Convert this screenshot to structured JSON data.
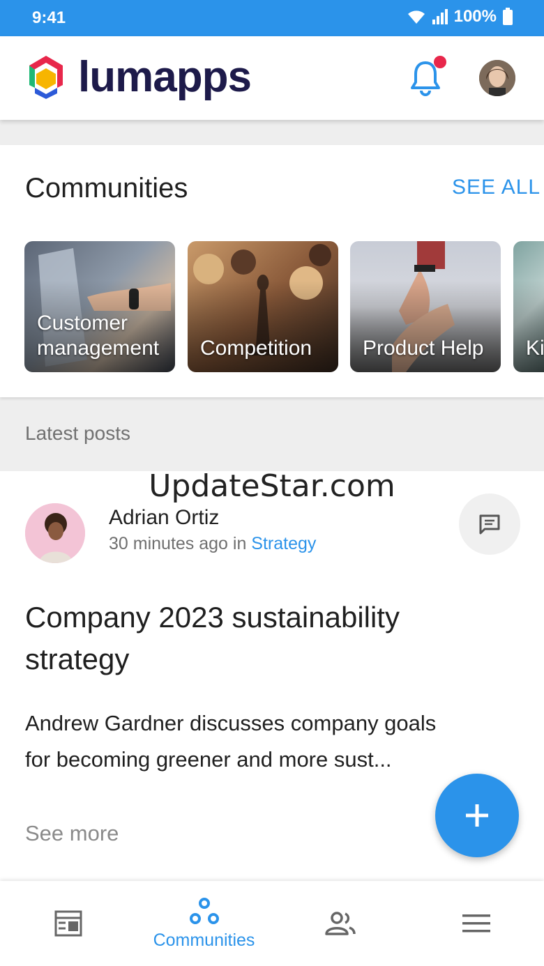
{
  "status_bar": {
    "time": "9:41",
    "battery": "100%"
  },
  "app_bar": {
    "logo_text": "lumapps",
    "avatar_alt": "user avatar"
  },
  "communities": {
    "title": "Communities",
    "see_all": "SEE ALL",
    "tiles": [
      {
        "label": "Customer management"
      },
      {
        "label": "Competition"
      },
      {
        "label": "Product Help"
      },
      {
        "label": "Ki"
      }
    ]
  },
  "latest_posts": {
    "title": "Latest posts"
  },
  "watermark": "UpdateStar.com",
  "post": {
    "author": "Adrian Ortiz",
    "time_ago": "30 minutes ago in ",
    "community": "Strategy",
    "title": "Company 2023 sustainability strategy",
    "excerpt": "Andrew Gardner discusses company goals for becoming greener and more sust...",
    "see_more": "See more"
  },
  "bottom_nav": {
    "items": [
      {
        "icon": "feed-icon",
        "label": ""
      },
      {
        "icon": "communities-icon",
        "label": "Communities",
        "active": true
      },
      {
        "icon": "people-icon",
        "label": ""
      },
      {
        "icon": "menu-icon",
        "label": ""
      }
    ]
  },
  "colors": {
    "accent": "#2b93ea",
    "brand_dark": "#1d1a4a",
    "notification": "#e8274b"
  }
}
